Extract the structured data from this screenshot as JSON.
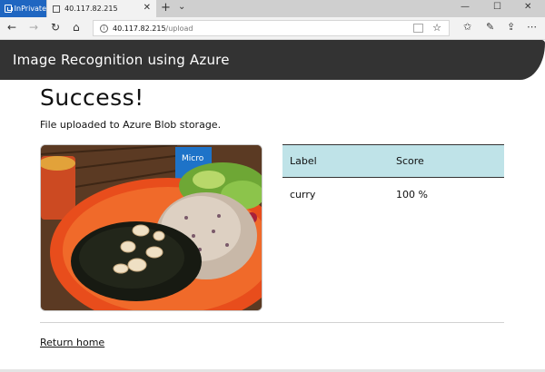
{
  "browser": {
    "inprivate_label": "InPrivate",
    "tab_title": "40.117.82.215",
    "url_host": "40.117.82.215",
    "url_path": "/upload"
  },
  "header": {
    "title": "Image Recognition using Azure"
  },
  "main": {
    "heading": "Success!",
    "message": "File uploaded to Azure Blob storage.",
    "photo_sign_text": "Micro",
    "table": {
      "columns": [
        "Label",
        "Score"
      ],
      "rows": [
        {
          "label": "curry",
          "score": "100 %"
        }
      ]
    },
    "return_link": "Return home"
  },
  "colors": {
    "header_bg": "#333333",
    "table_header_bg": "#bfe3e8",
    "inprivate_bg": "#1f66c1"
  }
}
